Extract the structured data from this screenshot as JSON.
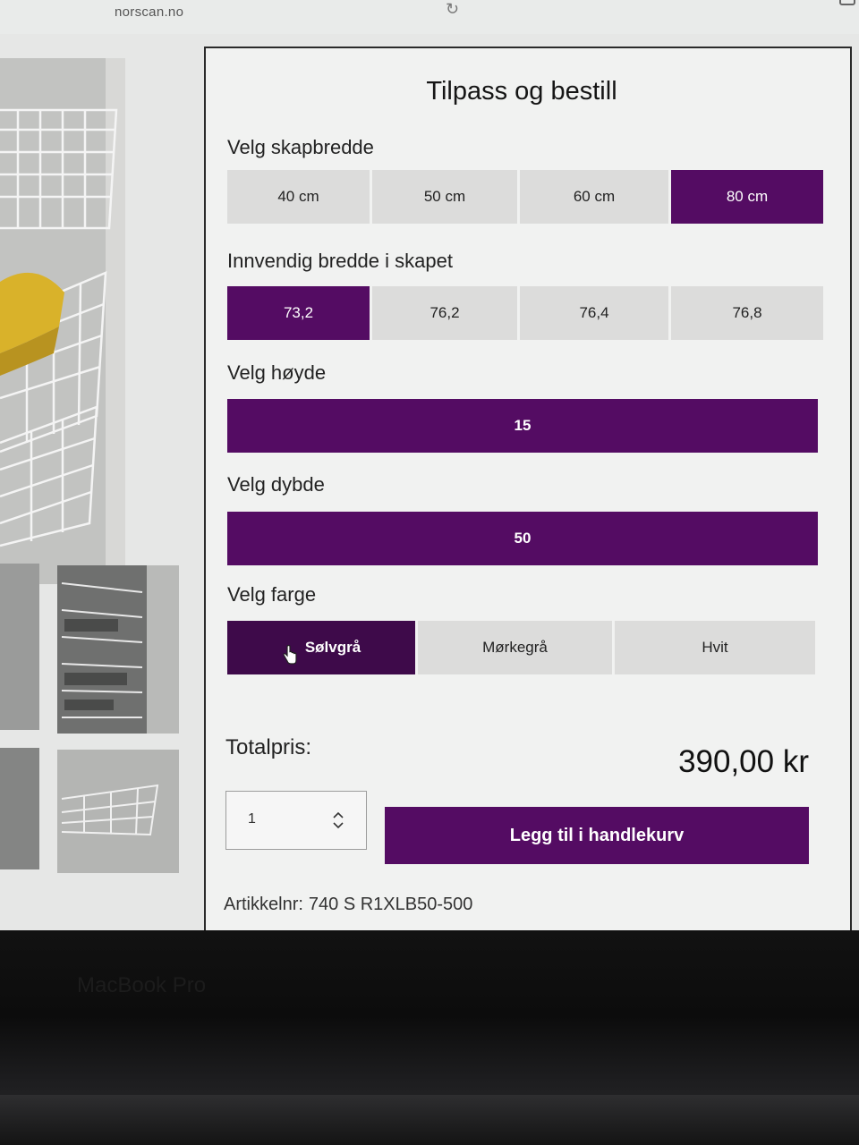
{
  "browser": {
    "url": "norscan.no",
    "reload_icon": "reload-icon"
  },
  "panel": {
    "title": "Tilpass og bestill",
    "width_section": {
      "label": "Velg skapbredde",
      "options": [
        "40 cm",
        "50 cm",
        "60 cm",
        "80 cm"
      ],
      "selected": "80 cm"
    },
    "inner_width_section": {
      "label": "Innvendig bredde i skapet",
      "options": [
        "73,2",
        "76,2",
        "76,4",
        "76,8"
      ],
      "selected": "73,2"
    },
    "height_section": {
      "label": "Velg høyde",
      "value": "15"
    },
    "depth_section": {
      "label": "Velg dybde",
      "value": "50"
    },
    "color_section": {
      "label": "Velg farge",
      "options": [
        "Sølvgrå",
        "Mørkegrå",
        "Hvit"
      ],
      "selected": "Sølvgrå"
    },
    "total": {
      "label": "Totalpris:",
      "value": "390,00 kr"
    },
    "quantity": {
      "value": "1"
    },
    "add_to_cart": "Legg til i handlekurv",
    "sku": {
      "label": "Artikkelnr:",
      "value": "740 S R1XLB50-500"
    }
  },
  "laptop": {
    "brand": "MacBook Pro"
  },
  "colors": {
    "accent": "#540c63",
    "accent_dark": "#3e0a4a",
    "option_bg": "#dcdcdb"
  }
}
